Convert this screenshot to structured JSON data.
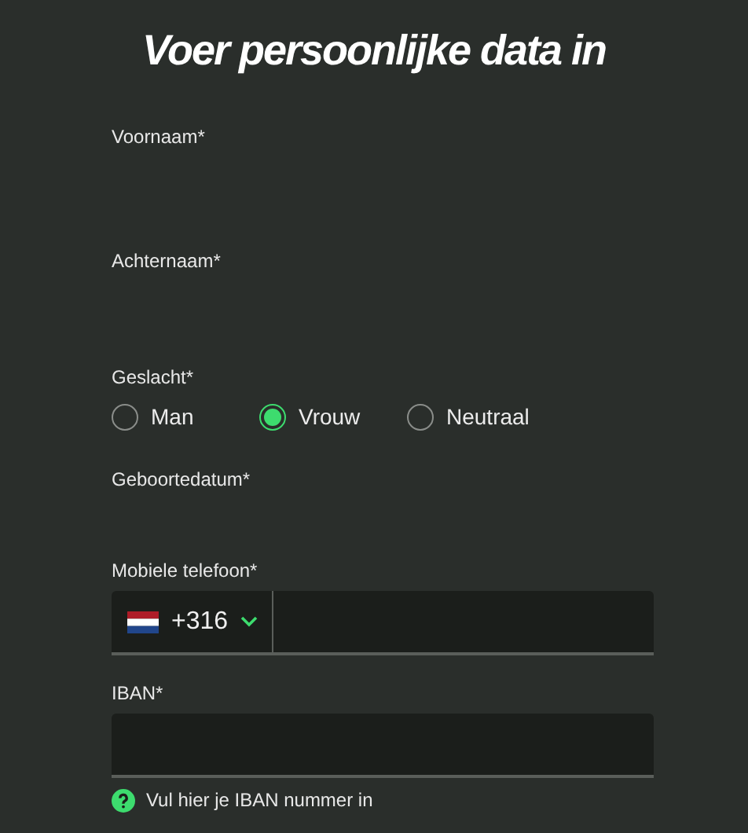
{
  "title": "Voer persoonlijke data in",
  "fields": [
    {
      "kind": "text",
      "label": "Voornaam*"
    },
    {
      "kind": "text",
      "label": "Achternaam*"
    },
    {
      "kind": "radio",
      "label": "Geslacht*",
      "options": [
        {
          "label": "Man",
          "selected": false
        },
        {
          "label": "Vrouw",
          "selected": true
        },
        {
          "label": "Neutraal",
          "selected": false
        }
      ]
    },
    {
      "kind": "text",
      "label": "Geboortedatum*"
    },
    {
      "kind": "phone",
      "label": "Mobiele telefoon*",
      "prefix": "+316"
    },
    {
      "kind": "input",
      "label": "IBAN*",
      "help": "Vul hier je IBAN nummer in"
    }
  ]
}
